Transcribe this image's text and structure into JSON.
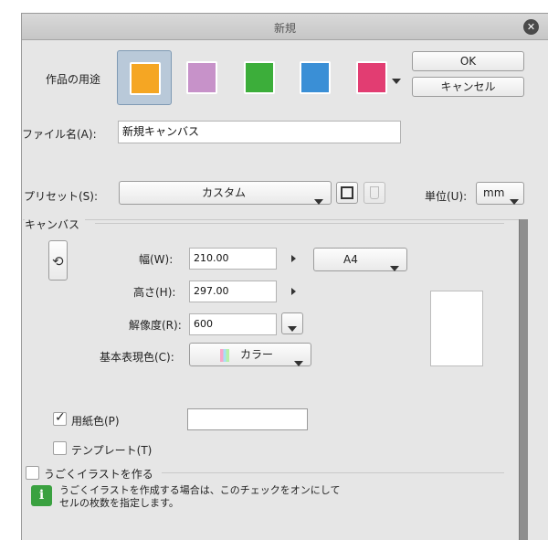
{
  "dialog": {
    "title": "新規",
    "ok_label": "OK",
    "cancel_label": "キャンセル"
  },
  "usage": {
    "label": "作品の用途",
    "options": [
      {
        "name": "illustration",
        "color": "#f5a623"
      },
      {
        "name": "comic",
        "color": "#c792c9"
      },
      {
        "name": "show-all-comic-settings",
        "color": "#3cae3a"
      },
      {
        "name": "webtoon",
        "color": "#3a8fd6"
      },
      {
        "name": "animation",
        "color": "#e23d72"
      }
    ],
    "selected_index": 0
  },
  "file_name": {
    "label": "ファイル名(A):",
    "value": "新規キャンバス"
  },
  "preset": {
    "label": "プリセット(S):",
    "value": "カスタム",
    "unit_label": "単位(U):",
    "unit_value": "mm"
  },
  "canvas": {
    "group_label": "キャンバス",
    "width_label": "幅(W):",
    "width_value": "210.00",
    "height_label": "高さ(H):",
    "height_value": "297.00",
    "size_preset": "A4",
    "resolution_label": "解像度(R):",
    "resolution_value": "600",
    "color_mode_label": "基本表現色(C):",
    "color_mode_value": "カラー"
  },
  "paper_color": {
    "label": "用紙色(P)",
    "checked": true,
    "color": "#ffffff"
  },
  "template": {
    "label": "テンプレート(T)",
    "checked": false
  },
  "animated": {
    "label": "うごくイラストを作る",
    "checked": false,
    "info_line1": "うごくイラストを作成する場合は、このチェックをオンにして",
    "info_line2": "セルの枚数を指定します。"
  }
}
